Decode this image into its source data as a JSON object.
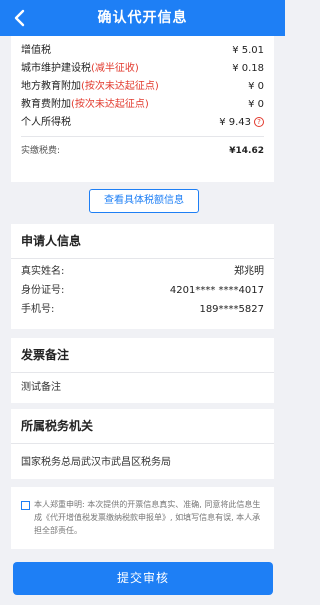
{
  "header": {
    "title": "确认代开信息"
  },
  "taxes": {
    "rows": [
      {
        "name": "增值税",
        "note": "",
        "amount": "¥ 5.01"
      },
      {
        "name": "城市维护建设税",
        "note": "(减半征收)",
        "amount": "¥ 0.18"
      },
      {
        "name": "地方教育附加",
        "note": "(按次未达起征点)",
        "amount": "¥ 0"
      },
      {
        "name": "教育费附加",
        "note": "(按次未达起征点)",
        "amount": "¥ 0"
      },
      {
        "name": "个人所得税",
        "note": "",
        "amount": "¥ 9.43",
        "warn_icon": "?"
      }
    ],
    "total_label": "实缴税费:",
    "total_amount": "¥14.62"
  },
  "detail_button": "查看具体税额信息",
  "applicant": {
    "title": "申请人信息",
    "rows": [
      {
        "label": "真实姓名:",
        "value": "郑兆明"
      },
      {
        "label": "身份证号:",
        "value": "4201**** ****4017"
      },
      {
        "label": "手机号:",
        "value": "189****5827"
      }
    ]
  },
  "remark": {
    "title": "发票备注",
    "text": "测试备注"
  },
  "tax_office": {
    "title": "所属税务机关",
    "text": "国家税务总局武汉市武昌区税务局"
  },
  "consent": {
    "text": "本人郑重申明: 本次提供的开票信息真实、准确, 同意将此信息生成《代开增值税发票缴纳税款申报单》, 如填写信息有误, 本人承担全部责任。"
  },
  "submit_button": "提交审核",
  "colors": {
    "primary": "#1e7ff5",
    "warning": "#e23a2e",
    "background": "#f0f1f5"
  }
}
